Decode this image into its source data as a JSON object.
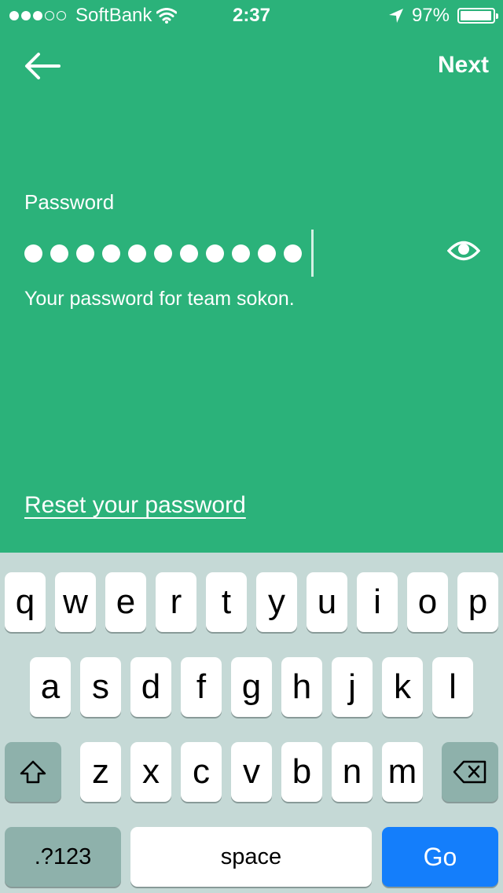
{
  "status_bar": {
    "carrier": "SoftBank",
    "time": "2:37",
    "battery": "97%",
    "battery_level": 0.97,
    "signal_bars_filled": 3,
    "signal_bars_total": 5,
    "icons": [
      "wifi-icon",
      "location-arrow-icon",
      "battery-icon"
    ]
  },
  "nav": {
    "back_icon": "back-arrow-icon",
    "next_label": "Next"
  },
  "form": {
    "label": "Password",
    "masked_length": 11,
    "helper_text": "Your password for team sokon.",
    "toggle_icon": "eye-icon",
    "reset_link": "Reset your password"
  },
  "colors": {
    "background": "#2BB27A",
    "keyboard_bg": "#C5D9D6",
    "go_key": "#147EFB"
  },
  "keyboard": {
    "row1": [
      "q",
      "w",
      "e",
      "r",
      "t",
      "y",
      "u",
      "i",
      "o",
      "p"
    ],
    "row2": [
      "a",
      "s",
      "d",
      "f",
      "g",
      "h",
      "j",
      "k",
      "l"
    ],
    "row3": [
      "z",
      "x",
      "c",
      "v",
      "b",
      "n",
      "m"
    ],
    "shift_icon": "shift-icon",
    "delete_icon": "backspace-icon",
    "numbers_label": ".?123",
    "space_label": "space",
    "go_label": "Go"
  }
}
